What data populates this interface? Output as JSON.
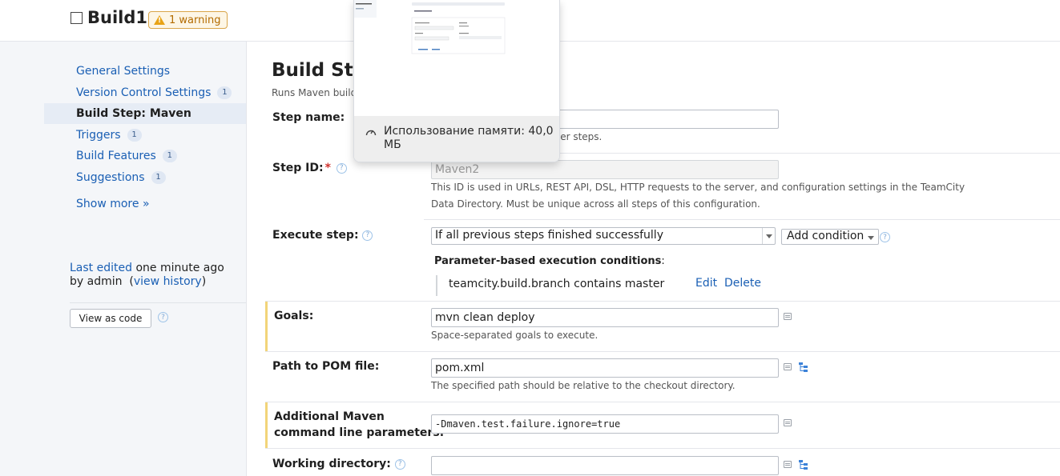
{
  "header": {
    "title": "Build1",
    "warning_label": "1 warning"
  },
  "sidebar": {
    "items": [
      {
        "label": "General Settings",
        "count": ""
      },
      {
        "label": "Version Control Settings",
        "count": "1"
      },
      {
        "label": "Build Step: Maven",
        "count": ""
      },
      {
        "label": "Triggers",
        "count": "1"
      },
      {
        "label": "Build Features",
        "count": "1"
      },
      {
        "label": "Suggestions",
        "count": "1"
      }
    ],
    "show_more": "Show more »",
    "last_edited_link": "Last edited",
    "last_edited_time": " one minute ago",
    "by_user": "by admin",
    "view_history": "view history",
    "view_as_code": "View as code"
  },
  "main": {
    "title": "Build Ste",
    "subtitle": "Runs Maven builds",
    "step_name": {
      "label": "Step name:",
      "value": "",
      "hint": "ish this build step from other steps."
    },
    "step_id": {
      "label": "Step ID:",
      "value": "Maven2",
      "hint_line1": "This ID is used in URLs, REST API, DSL, HTTP requests to the server, and configuration settings in the TeamCity",
      "hint_line2": "Data Directory. Must be unique across all steps of this configuration."
    },
    "execute_step": {
      "label": "Execute step:",
      "value": "If all previous steps finished successfully",
      "add_condition": "Add condition"
    },
    "conditions": {
      "title": "Parameter-based execution conditions",
      "items": [
        {
          "text": "teamcity.build.branch contains master",
          "edit": "Edit",
          "delete": "Delete"
        }
      ]
    },
    "goals": {
      "label": "Goals:",
      "value": "mvn clean deploy",
      "hint": "Space-separated goals to execute."
    },
    "pom": {
      "label": "Path to POM file:",
      "value": "pom.xml",
      "hint": "The specified path should be relative to the checkout directory."
    },
    "maven_params": {
      "label_line1": "Additional Maven",
      "label_line2": "command line parameters:",
      "value": "-Dmaven.test.failure.ignore=true"
    },
    "working_dir": {
      "label": "Working directory:",
      "value": ""
    }
  },
  "popup": {
    "memory_text": "Использование памяти: 40,0 МБ"
  },
  "colors": {
    "link": "#1a5fb4",
    "warning": "#e8a317",
    "modified_bar": "#f2d479"
  }
}
